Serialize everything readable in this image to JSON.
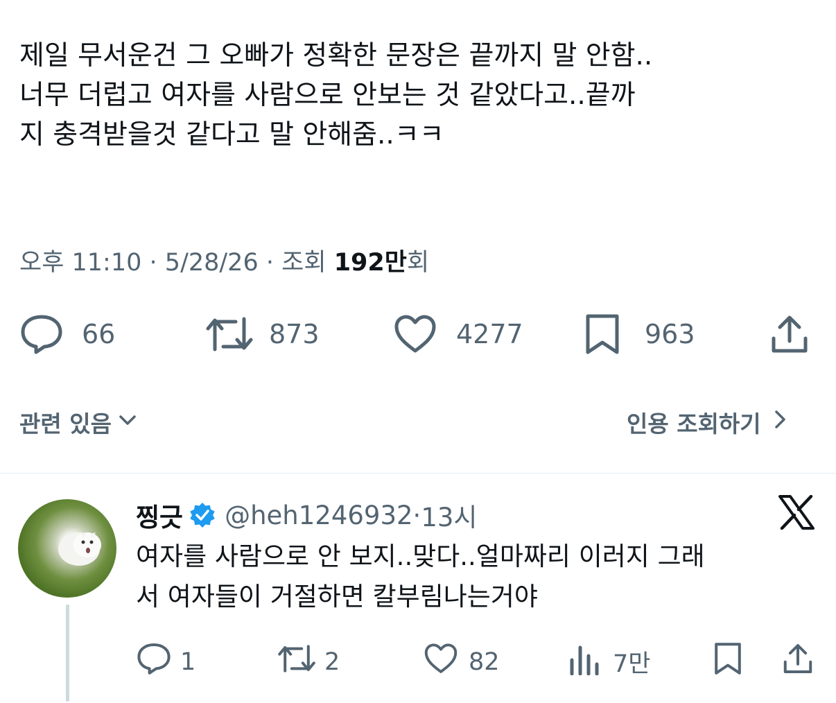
{
  "tweet": {
    "text": "제일 무서운건 그 오빠가 정확한 문장은 끝까지 말 안함..\n너무 더럽고 여자를 사람으로 안보는 것 같았다고..끝까\n지 충격받을것 같다고 말 안해줌..ㅋㅋ",
    "time": "오후 11:10",
    "date": "5/28/26",
    "views_label": "조회",
    "views_count": "192만",
    "views_suffix": "회",
    "stats": {
      "replies": "66",
      "retweets": "873",
      "likes": "4277",
      "bookmarks": "963"
    }
  },
  "links": {
    "related": "관련 있음",
    "quote_views": "인용 조회하기"
  },
  "reply": {
    "name": "찡긋",
    "handle": "@heh1246932",
    "time": "13시",
    "text": "여자를 사람으로 안 보지..맞다..얼마짜리 이러지 그래\n서 여자들이 거절하면 칼부림나는거야",
    "stats": {
      "replies": "1",
      "retweets": "2",
      "likes": "82",
      "views": "7만"
    }
  },
  "colors": {
    "text": "#0f1419",
    "secondary": "#536471",
    "verified": "#1d9bf0",
    "divider": "#e6ecf0"
  },
  "icons": [
    "reply-icon",
    "retweet-icon",
    "like-icon",
    "bookmark-icon",
    "share-icon",
    "chevron-down-icon",
    "chevron-right-icon",
    "verified-badge-icon",
    "x-logo-icon",
    "views-icon"
  ]
}
